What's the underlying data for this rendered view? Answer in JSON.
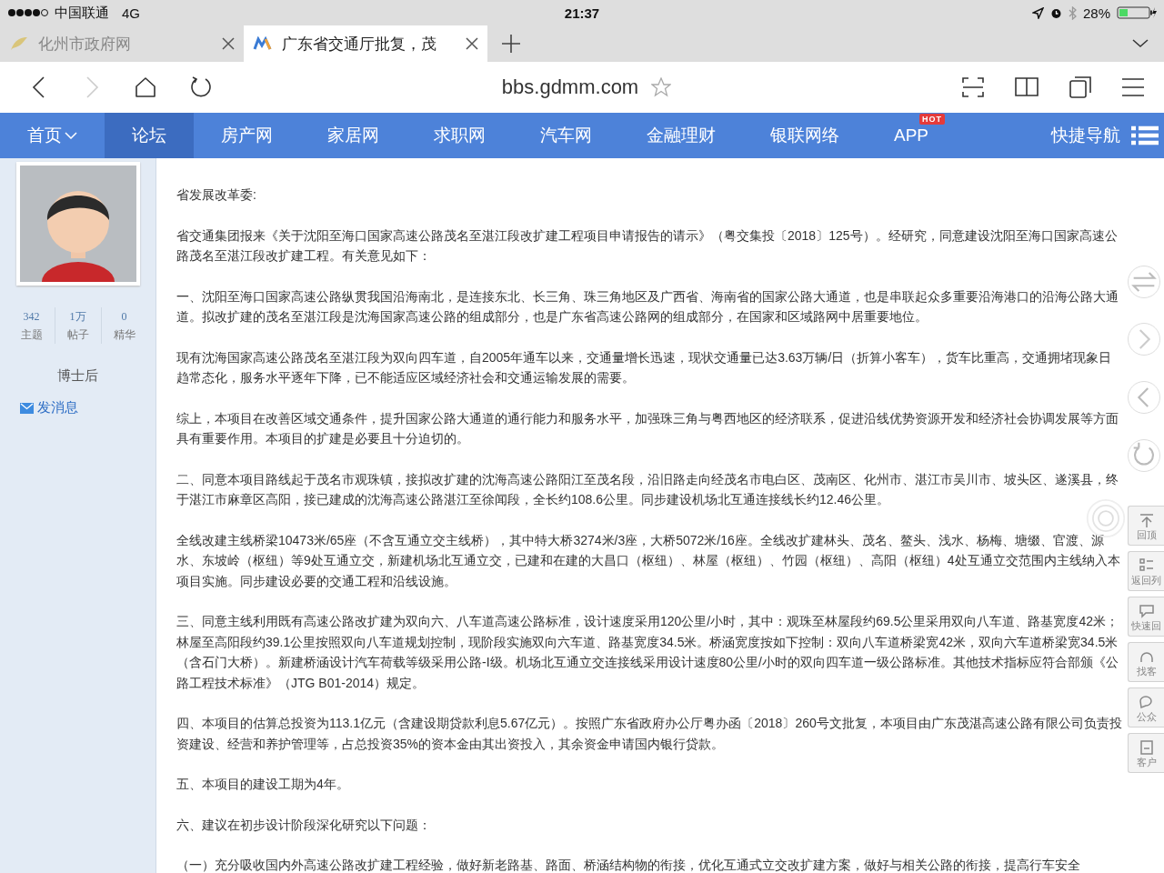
{
  "status_bar": {
    "carrier": "中国联通",
    "network": "4G",
    "time": "21:37",
    "battery": "28%"
  },
  "tabs": [
    {
      "title": "化州市政府网",
      "selected": false
    },
    {
      "title": "广东省交通厅批复，茂",
      "selected": true
    }
  ],
  "address_bar": {
    "url": "bbs.gdmm.com",
    "can_go_forward": false
  },
  "site_nav": {
    "items": [
      {
        "label": "首页",
        "selected": false,
        "dropdown": true
      },
      {
        "label": "论坛",
        "selected": true,
        "dropdown": false
      },
      {
        "label": "房产网",
        "selected": false,
        "dropdown": false
      },
      {
        "label": "家居网",
        "selected": false,
        "dropdown": false
      },
      {
        "label": "求职网",
        "selected": false,
        "dropdown": false
      },
      {
        "label": "汽车网",
        "selected": false,
        "dropdown": false
      },
      {
        "label": "金融理财",
        "selected": false,
        "dropdown": false
      },
      {
        "label": "银联网络",
        "selected": false,
        "dropdown": false
      },
      {
        "label": "APP",
        "selected": false,
        "dropdown": false,
        "badge": "HOT"
      }
    ],
    "shortcut": "快捷导航"
  },
  "profile": {
    "stats": [
      {
        "value": "342",
        "label": "主题"
      },
      {
        "value": "1万",
        "label": "帖子"
      },
      {
        "value": "0",
        "label": "精华"
      }
    ],
    "rank": "博士后",
    "message_link": "发消息"
  },
  "post": {
    "paragraphs": [
      "省发展改革委:",
      "省交通集团报来《关于沈阳至海口国家高速公路茂名至湛江段改扩建工程项目申请报告的请示》（粤交集投〔2018〕125号）。经研究，同意建设沈阳至海口国家高速公路茂名至湛江段改扩建工程。有关意见如下：",
      "一、沈阳至海口国家高速公路纵贯我国沿海南北，是连接东北、长三角、珠三角地区及广西省、海南省的国家公路大通道，也是串联起众多重要沿海港口的沿海公路大通道。拟改扩建的茂名至湛江段是沈海国家高速公路的组成部分，也是广东省高速公路网的组成部分，在国家和区域路网中居重要地位。",
      "现有沈海国家高速公路茂名至湛江段为双向四车道，自2005年通车以来，交通量增长迅速，现状交通量已达3.63万辆/日（折算小客车），货车比重高，交通拥堵现象日趋常态化，服务水平逐年下降，已不能适应区域经济社会和交通运输发展的需要。",
      "综上，本项目在改善区域交通条件，提升国家公路大通道的通行能力和服务水平，加强珠三角与粤西地区的经济联系，促进沿线优势资源开发和经济社会协调发展等方面具有重要作用。本项目的扩建是必要且十分迫切的。",
      "二、同意本项目路线起于茂名市观珠镇，接拟改扩建的沈海高速公路阳江至茂名段，沿旧路走向经茂名市电白区、茂南区、化州市、湛江市吴川市、坡头区、遂溪县，终于湛江市麻章区高阳，接已建成的沈海高速公路湛江至徐闻段，全长约108.6公里。同步建设机场北互通连接线长约12.46公里。",
      "全线改建主线桥梁10473米/65座（不含互通立交主线桥），其中特大桥3274米/3座，大桥5072米/16座。全线改扩建林头、茂名、鳌头、浅水、杨梅、塘缀、官渡、源水、东坡岭（枢纽）等9处互通立交，新建机场北互通立交，已建和在建的大昌口（枢纽）、林屋（枢纽）、竹园（枢纽）、高阳（枢纽）4处互通立交范围内主线纳入本项目实施。同步建设必要的交通工程和沿线设施。",
      "三、同意主线利用既有高速公路改扩建为双向六、八车道高速公路标准，设计速度采用120公里/小时，其中：观珠至林屋段约69.5公里采用双向八车道、路基宽度42米；林屋至高阳段约39.1公里按照双向八车道规划控制，现阶段实施双向六车道、路基宽度34.5米。桥涵宽度按如下控制：双向八车道桥梁宽42米，双向六车道桥梁宽34.5米（含石门大桥）。新建桥涵设计汽车荷载等级采用公路-I级。机场北互通立交连接线采用设计速度80公里/小时的双向四车道一级公路标准。其他技术指标应符合部颁《公路工程技术标准》（JTG B01-2014）规定。",
      "四、本项目的估算总投资为113.1亿元（含建设期贷款利息5.67亿元）。按照广东省政府办公厅粤办函〔2018〕260号文批复，本项目由广东茂湛高速公路有限公司负责投资建设、经营和养护管理等，占总投资35%的资本金由其出资投入，其余资金申请国内银行贷款。",
      "五、本项目的建设工期为4年。",
      "六、建议在初步设计阶段深化研究以下问题：",
      "（一）充分吸收国内外高速公路改扩建工程经验，做好新老路基、路面、桥涵结构物的衔接，优化互通式立交改扩建方案，做好与相关公路的衔接，提高行车安全"
    ]
  },
  "side_tools": {
    "labels": [
      "回顶",
      "返回列",
      "快速回",
      "找客",
      "公众",
      "客户"
    ]
  }
}
